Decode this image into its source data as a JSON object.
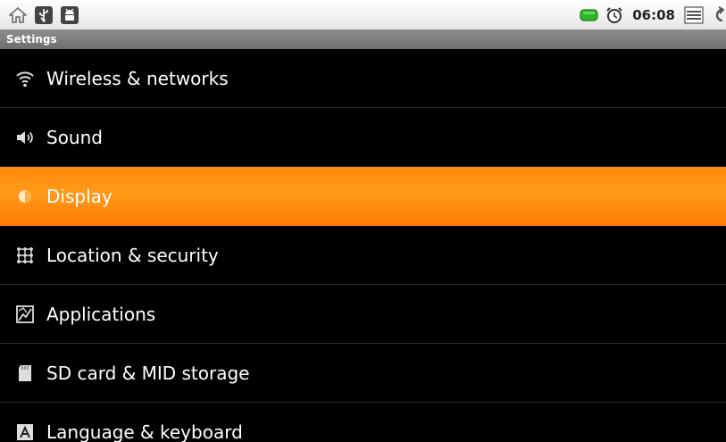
{
  "status_bar": {
    "left_icons": [
      "home-icon",
      "usb-icon",
      "android-debug-icon"
    ],
    "battery_icon": "battery-icon",
    "alarm_icon": "alarm-clock-icon",
    "time": "06:08",
    "right_icons": [
      "menu-icon",
      "back-icon"
    ]
  },
  "title_bar": {
    "title": "Settings"
  },
  "settings": {
    "selected_index": 2,
    "items": [
      {
        "label": "Wireless & networks",
        "icon": "wifi-icon"
      },
      {
        "label": "Sound",
        "icon": "speaker-icon"
      },
      {
        "label": "Display",
        "icon": "brightness-icon"
      },
      {
        "label": "Location & security",
        "icon": "location-grid-icon"
      },
      {
        "label": "Applications",
        "icon": "applications-icon"
      },
      {
        "label": "SD card & MID storage",
        "icon": "sd-card-icon"
      },
      {
        "label": "Language & keyboard",
        "icon": "language-icon"
      }
    ]
  },
  "colors": {
    "selected_highlight": "#ff8a0c",
    "battery": "#2fb526",
    "background": "#000000"
  }
}
